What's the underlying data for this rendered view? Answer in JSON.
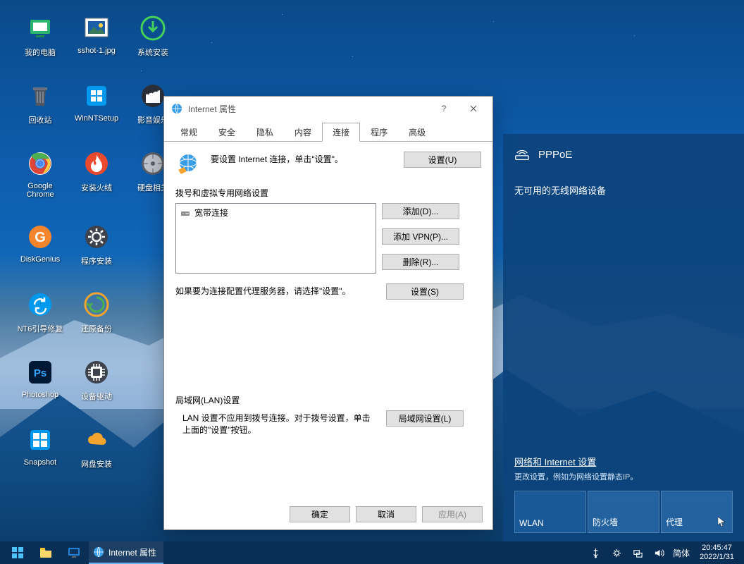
{
  "desktop": {
    "icons": [
      {
        "label": "我的电脑",
        "color": "#2cb66f",
        "shape": "pc"
      },
      {
        "label": "sshot-1.jpg",
        "color": "#1a5fa8",
        "shape": "img"
      },
      {
        "label": "系统安装",
        "color": "#45d05a",
        "shape": "arrow-down"
      },
      {
        "label": "回收站",
        "color": "#515761",
        "shape": "bin"
      },
      {
        "label": "WinNTSetup",
        "color": "#0099ee",
        "shape": "win"
      },
      {
        "label": "影音娱乐",
        "color": "#2a2f3a",
        "shape": "clap"
      },
      {
        "label": "Google\nChrome",
        "color": "#fff",
        "shape": "chrome"
      },
      {
        "label": "安装火绒",
        "color": "#ed492e",
        "shape": "flame"
      },
      {
        "label": "硬盘相关",
        "color": "#5a5f6a",
        "shape": "disk"
      },
      {
        "label": "DiskGenius",
        "color": "#f5852d",
        "shape": "g"
      },
      {
        "label": "程序安装",
        "color": "#3d424c",
        "shape": "gear"
      },
      {
        "label": "",
        "color": "",
        "shape": ""
      },
      {
        "label": "NT6引导修复",
        "color": "#0099ee",
        "shape": "sync"
      },
      {
        "label": "还原备份",
        "color": "#f5852d",
        "shape": "restore"
      },
      {
        "label": "",
        "color": "",
        "shape": ""
      },
      {
        "label": "Photoshop",
        "color": "#001833",
        "shape": "ps"
      },
      {
        "label": "设备驱动",
        "color": "#3d424c",
        "shape": "chip"
      },
      {
        "label": "",
        "color": "",
        "shape": ""
      },
      {
        "label": "Snapshot",
        "color": "#0099ee",
        "shape": "grid"
      },
      {
        "label": "网盘安装",
        "color": "#f5a52d",
        "shape": "cloud"
      }
    ]
  },
  "dialog": {
    "title": "Internet 属性",
    "help": "?",
    "tabs": [
      "常规",
      "安全",
      "隐私",
      "内容",
      "连接",
      "程序",
      "高级"
    ],
    "active_tab": 4,
    "setup_text": "要设置 Internet 连接，单击\"设置\"。",
    "setup_btn": "设置(U)",
    "dial_section": "拨号和虚拟专用网络设置",
    "conn_item": "宽带连接",
    "add_btn": "添加(D)...",
    "add_vpn_btn": "添加 VPN(P)...",
    "remove_btn": "删除(R)...",
    "proxy_text": "如果要为连接配置代理服务器，请选择\"设置\"。",
    "settings_btn": "设置(S)",
    "lan_section": "局域网(LAN)设置",
    "lan_text": "LAN 设置不应用到拨号连接。对于拨号设置，单击上面的\"设置\"按钮。",
    "lan_btn": "局域网设置(L)",
    "ok": "确定",
    "cancel": "取消",
    "apply": "应用(A)"
  },
  "flyout": {
    "conn_name": "PPPoE",
    "no_wifi": "无可用的无线网络设备",
    "link": "网络和 Internet 设置",
    "sub": "更改设置，例如为网络设置静态IP。",
    "tiles": [
      "WLAN",
      "防火墙",
      "代理"
    ]
  },
  "taskbar": {
    "task": "Internet 属性",
    "ime": "简体",
    "time": "20:45:47",
    "date": "2022/1/31"
  }
}
